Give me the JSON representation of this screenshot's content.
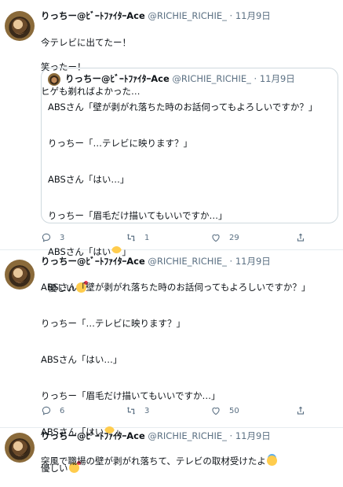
{
  "tweets": [
    {
      "name": "りっちー@ﾋﾞｰﾄﾌｧｲﾀｰAce",
      "handle": "@RICHIE_RICHIE_",
      "dot": "·",
      "date": "11月9日",
      "lines": [
        "今テレビに出てたー！",
        "笑ったー！",
        "ヒゲも剃ればよかった…"
      ],
      "quote": {
        "name": "りっちー@ﾋﾞｰﾄﾌｧｲﾀｰAce",
        "handle": "@RICHIE_RICHIE_",
        "dot": "·",
        "date": "11月9日",
        "paragraphs": [
          "ABSさん「壁が剥がれ落ちた時のお話伺ってもよろしいですか？」",
          "りっちー「…テレビに映ります？」",
          "ABSさん「はい…」",
          "りっちー「眉毛だけ描いてもいいですか…」",
          "ABSさん「はい",
          "優しい"
        ],
        "emoji": [
          "grinning-face-emoji",
          "smiling-face-with-hearts-emoji"
        ]
      },
      "counts": {
        "reply": "3",
        "retweet": "1",
        "like": "29"
      }
    },
    {
      "name": "りっちー@ﾋﾞｰﾄﾌｧｲﾀｰAce",
      "handle": "@RICHIE_RICHIE_",
      "dot": "·",
      "date": "11月9日",
      "paragraphs": [
        "ABSさん「壁が剥がれ落ちた時のお話伺ってもよろしいですか？」",
        "りっちー「…テレビに映ります？」",
        "ABSさん「はい…」",
        "りっちー「眉毛だけ描いてもいいですか…」",
        "ABSさん「はい",
        "優しい"
      ],
      "emoji": [
        "grinning-face-emoji",
        "smiling-face-with-hearts-emoji"
      ],
      "counts": {
        "reply": "6",
        "retweet": "3",
        "like": "50"
      }
    },
    {
      "name": "りっちー@ﾋﾞｰﾄﾌｧｲﾀｰAce",
      "handle": "@RICHIE_RICHIE_",
      "dot": "·",
      "date": "11月9日",
      "lines": [
        "突風で職場の壁が剥がれ落ちて、テレビの取材受けたよ"
      ],
      "emoji": [
        "smiling-face-with-halo-emoji"
      ]
    }
  ],
  "icons": [
    "reply-icon",
    "retweet-icon",
    "like-icon",
    "share-icon"
  ],
  "colors": {
    "text": "#0f1419",
    "secondary": "#5b7083",
    "border": "#e6ecf0"
  }
}
